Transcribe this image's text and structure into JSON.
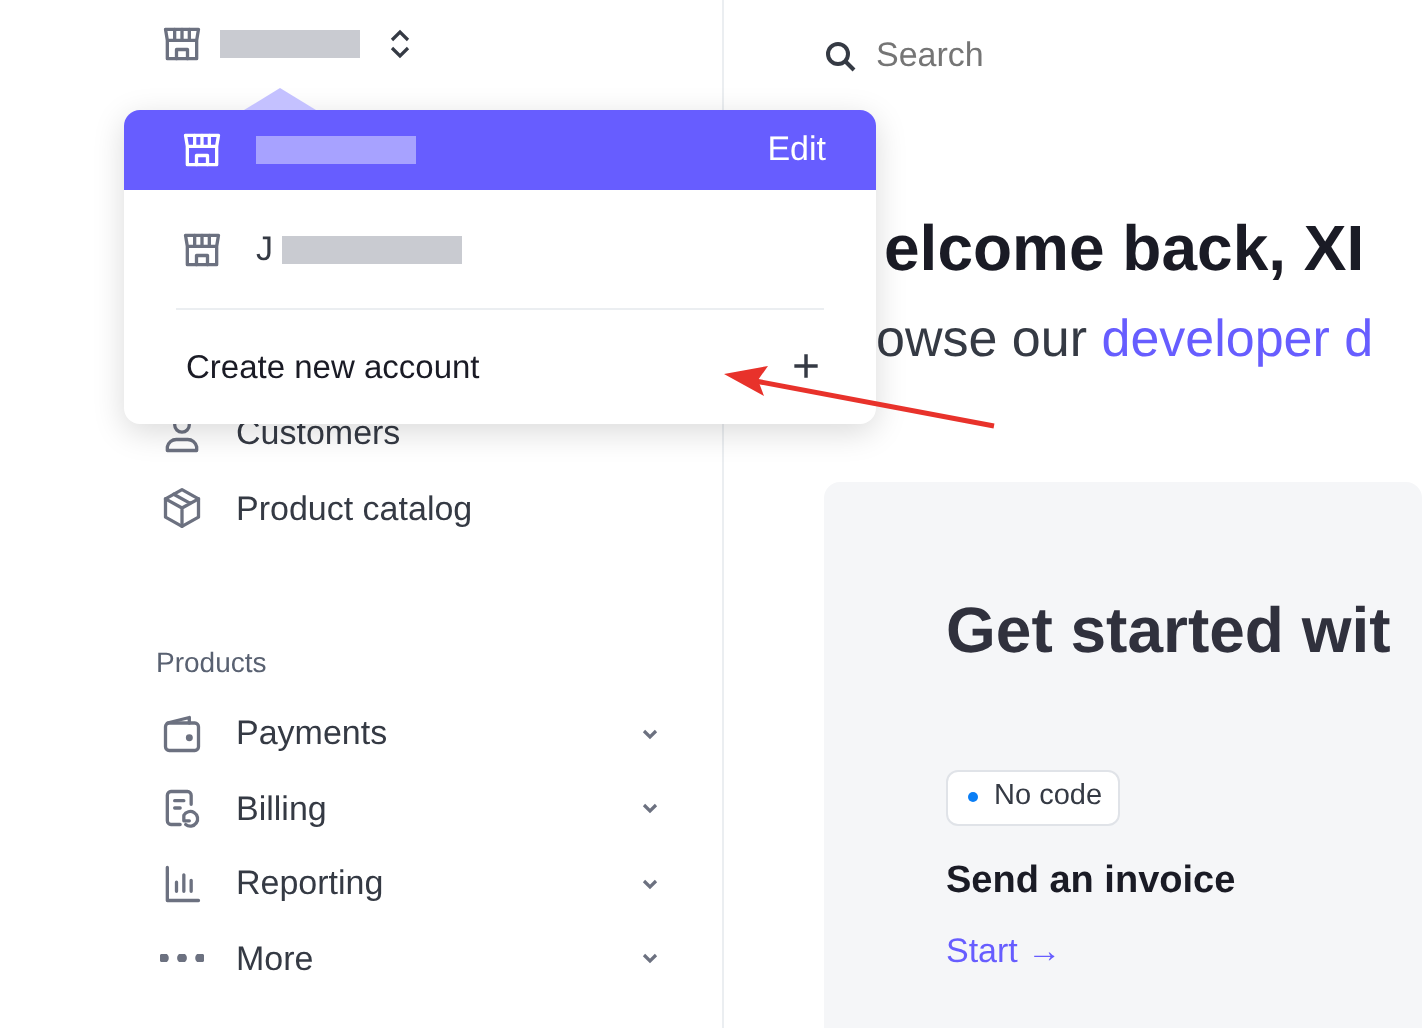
{
  "search": {
    "placeholder": "Search"
  },
  "sidebar": {
    "items": [
      {
        "label": "Customers",
        "kind": "person"
      },
      {
        "label": "Product catalog",
        "kind": "box"
      }
    ],
    "sections": [
      {
        "title": "Products",
        "items": [
          {
            "label": "Payments",
            "kind": "wallet",
            "expanded": false
          },
          {
            "label": "Billing",
            "kind": "invoice",
            "expanded": false
          },
          {
            "label": "Reporting",
            "kind": "chart",
            "expanded": false
          },
          {
            "label": "More",
            "kind": "dots",
            "expanded": false
          }
        ]
      }
    ]
  },
  "account_menu": {
    "accounts": [
      {
        "selected": true,
        "action": "Edit"
      },
      {
        "selected": false,
        "name": "J"
      }
    ],
    "create": {
      "label": "Create new account",
      "icon": "+"
    }
  },
  "main": {
    "welcome": "elcome back, XI",
    "subtitle": "owse our ",
    "subtitle_link": "developer d",
    "card": {
      "title": "Get started wit",
      "tag": "No code",
      "task": "Send an invoice",
      "action": "Start →"
    }
  }
}
